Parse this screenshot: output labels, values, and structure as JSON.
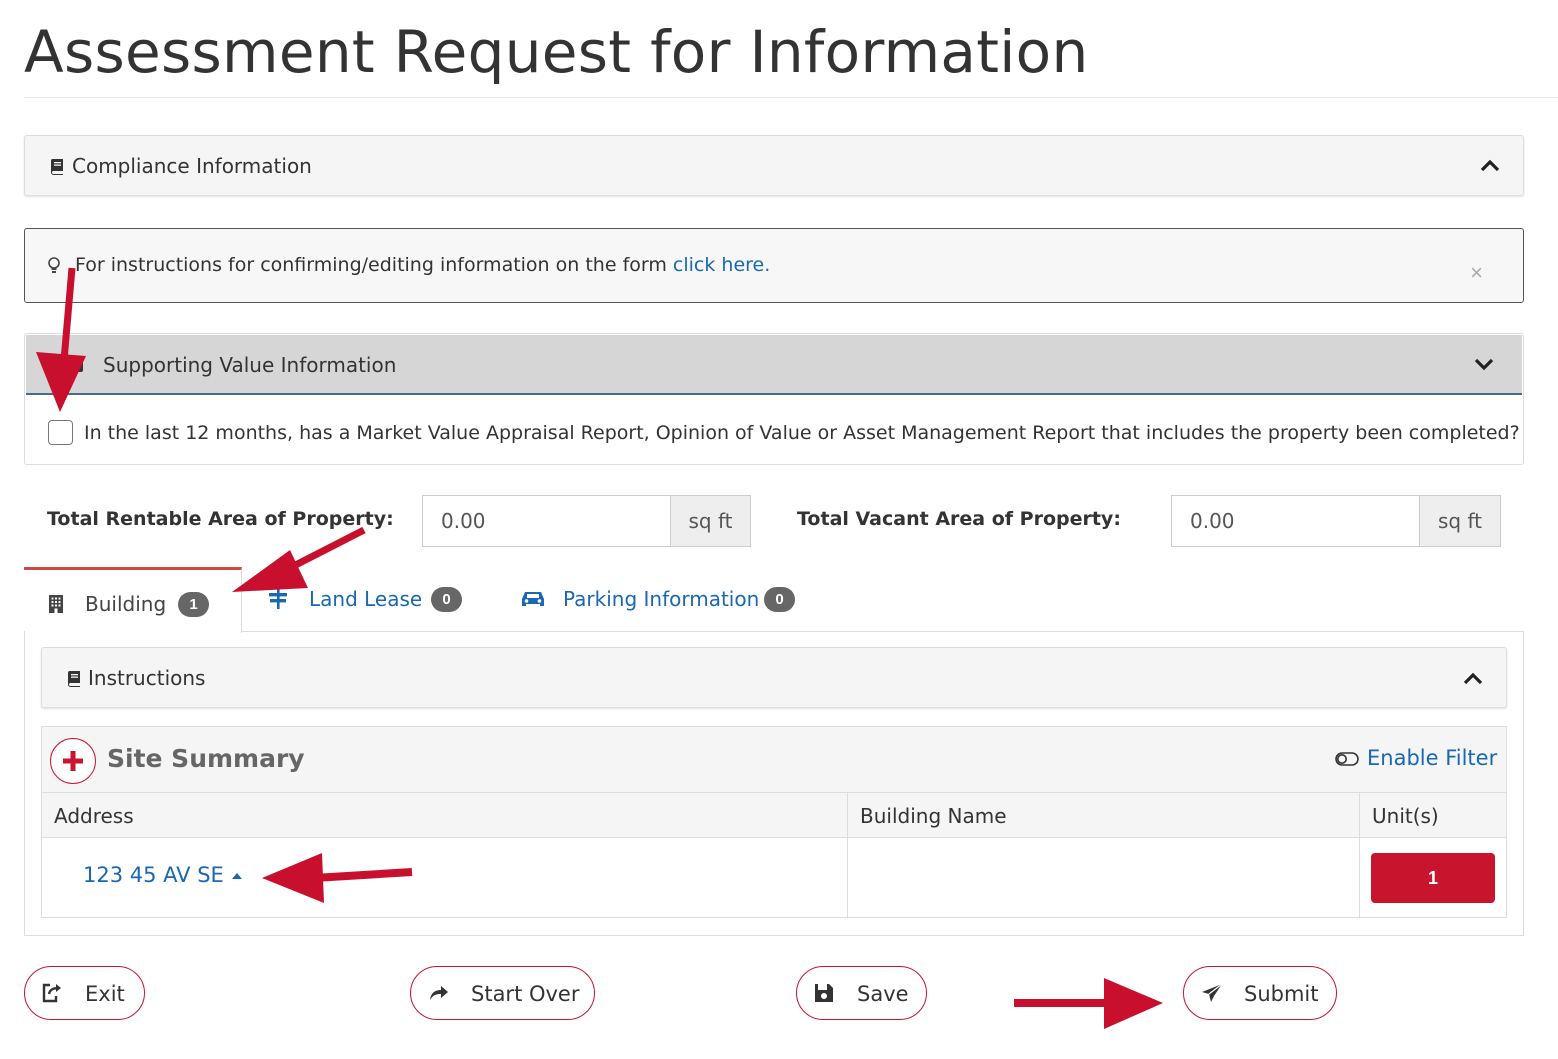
{
  "page": {
    "title": "Assessment Request for Information"
  },
  "compliance": {
    "label": "Compliance Information"
  },
  "alert": {
    "text": "For instructions for confirming/editing information on the form ",
    "link": "click here.",
    "close": "×"
  },
  "supporting": {
    "label": "Supporting Value Information",
    "question": "In the last 12 months, has a Market Value Appraisal Report, Opinion of Value or Asset Management Report that includes the property been completed?"
  },
  "areas": {
    "rentable": {
      "label": "Total Rentable Area of Property:",
      "value": "0.00",
      "unit": "sq ft"
    },
    "vacant": {
      "label": "Total Vacant Area of Property:",
      "value": "0.00",
      "unit": "sq ft"
    }
  },
  "tabs": [
    {
      "label": "Building",
      "count": "1",
      "active": true
    },
    {
      "label": "Land Lease",
      "count": "0",
      "active": false
    },
    {
      "label": "Parking Information",
      "count": "0",
      "active": false
    }
  ],
  "instructions": {
    "label": "Instructions"
  },
  "site_summary": {
    "title": "Site Summary",
    "filter_label": "Enable Filter",
    "columns": [
      "Address",
      "Building Name",
      "Unit(s)"
    ],
    "rows": [
      {
        "address": "123 45 AV SE",
        "building_name": "",
        "units": "1"
      }
    ]
  },
  "actions": {
    "exit": "Exit",
    "start_over": "Start Over",
    "save": "Save",
    "submit": "Submit"
  },
  "colors": {
    "accent_red": "#c9142d",
    "link_blue": "#1a67b3",
    "annotation_arrow": "#c8102e"
  }
}
